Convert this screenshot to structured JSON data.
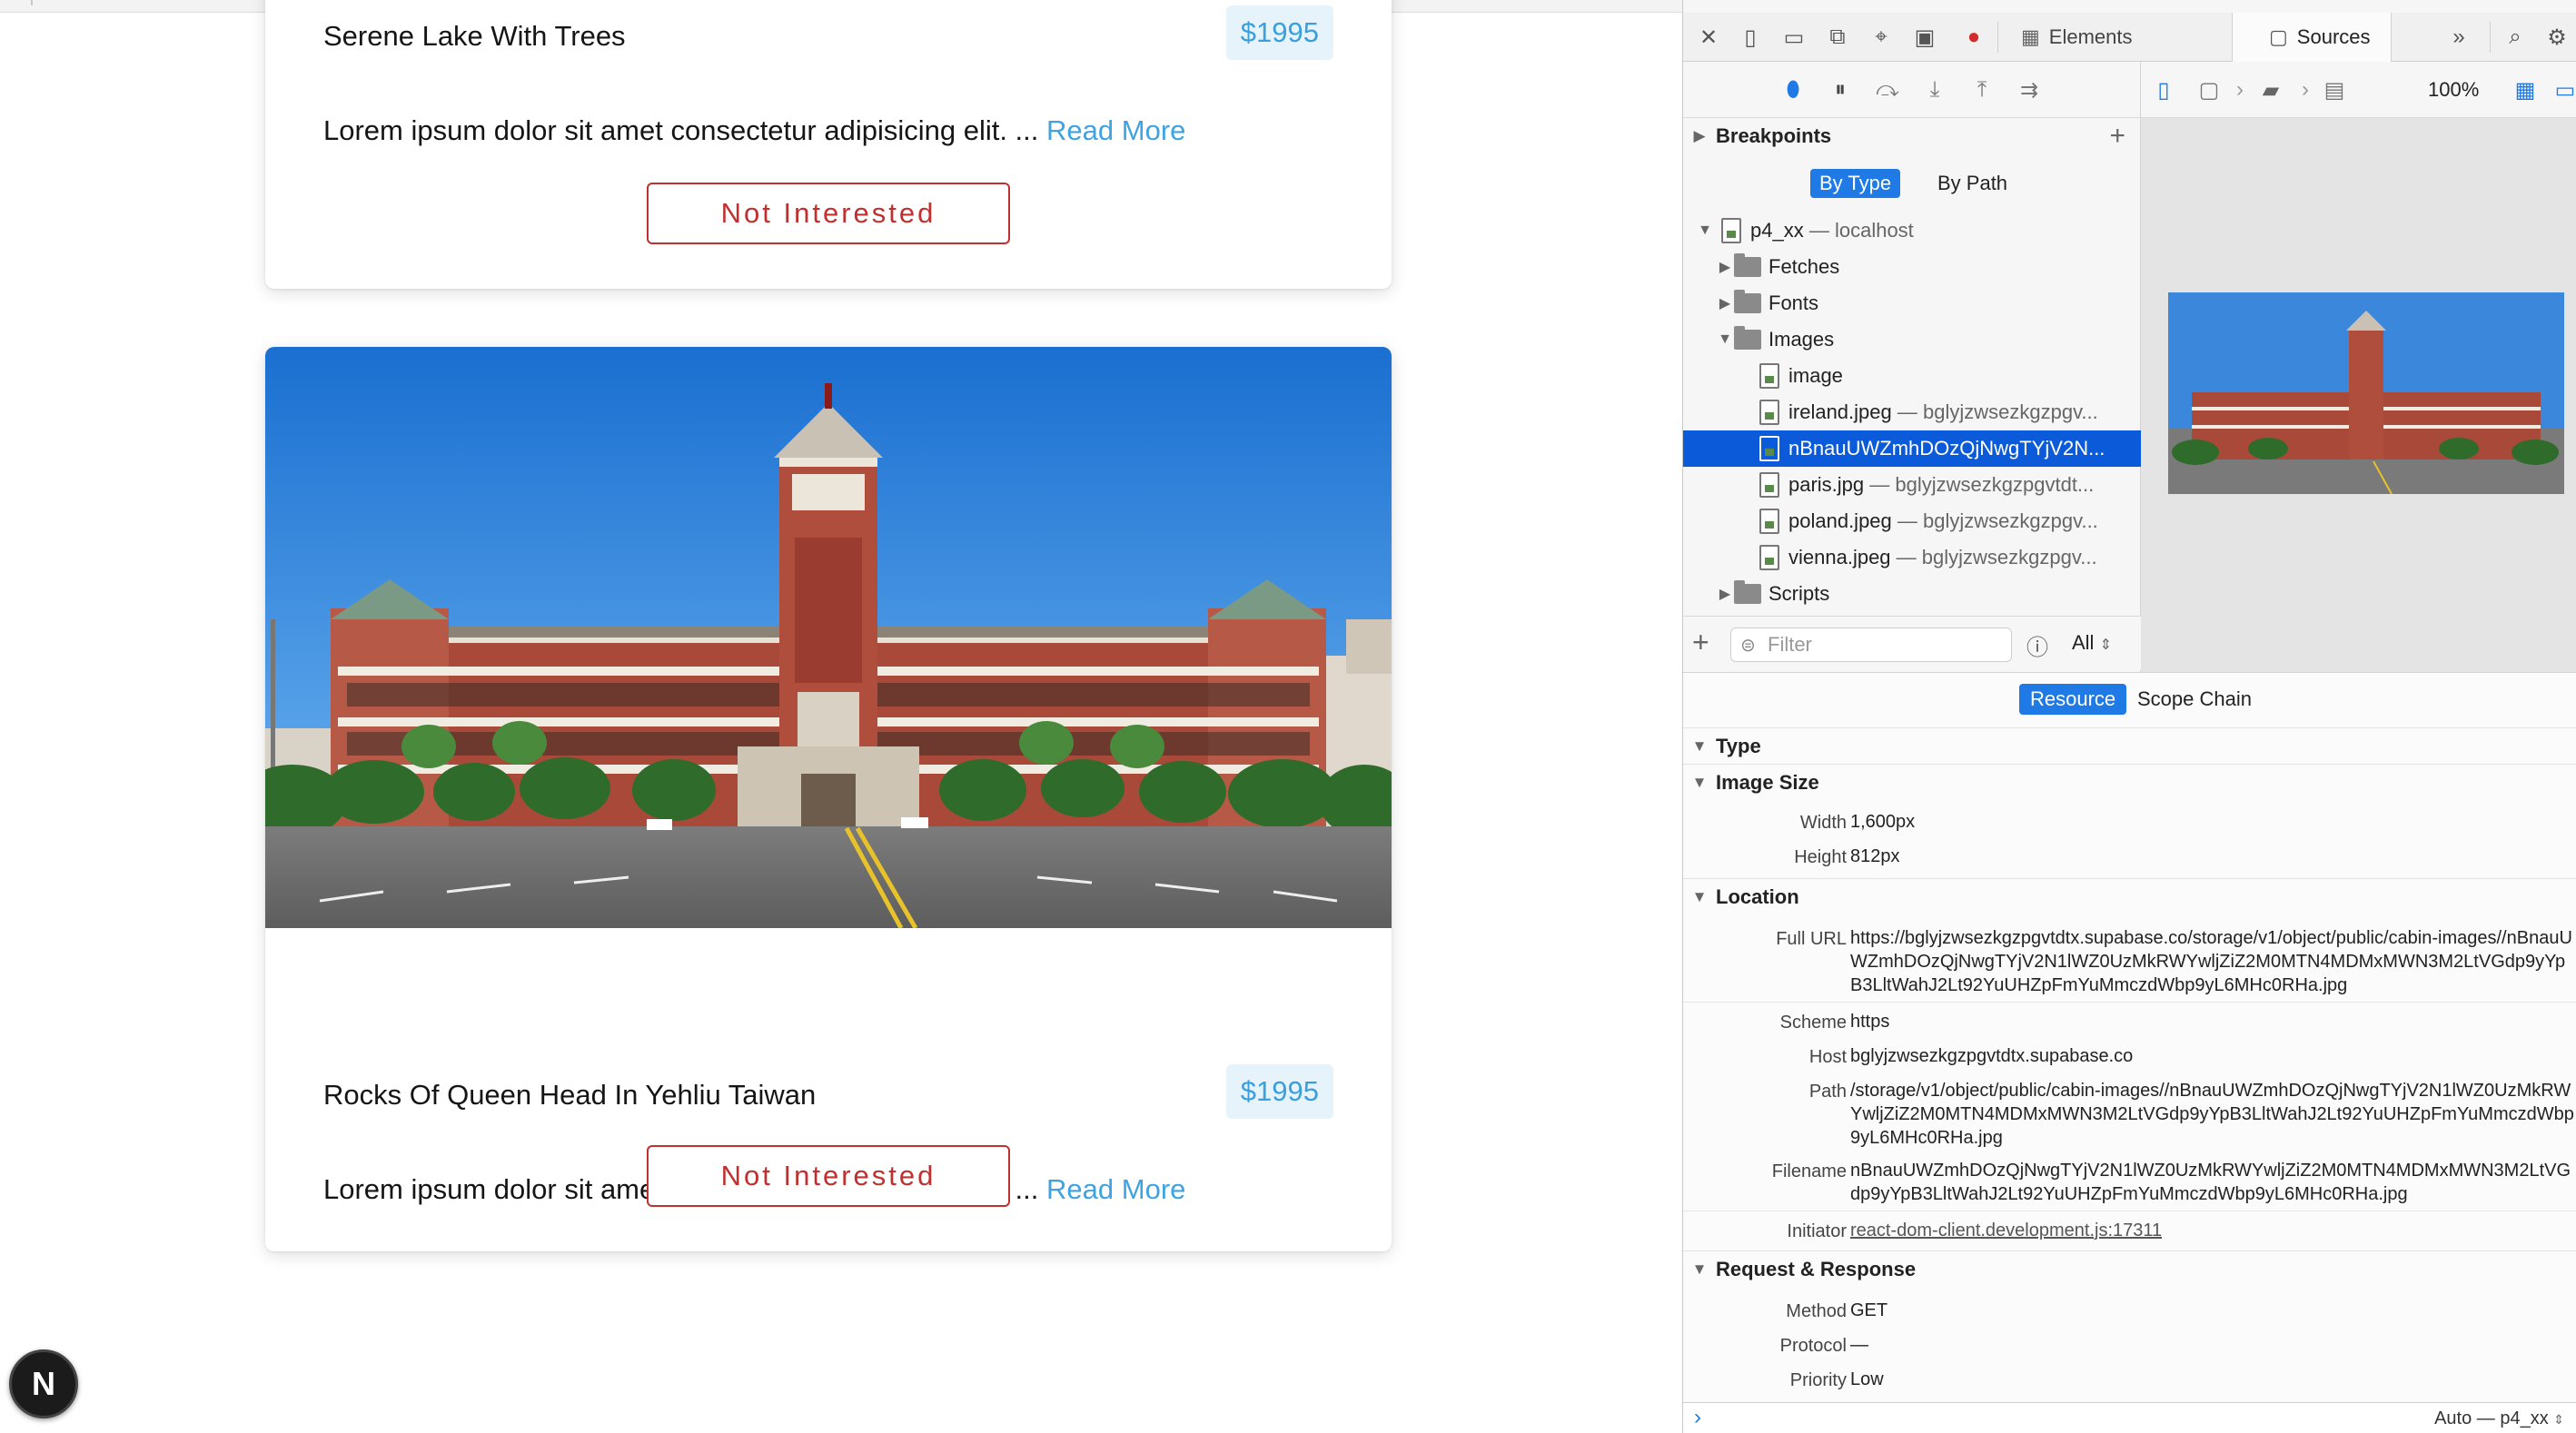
{
  "cards": [
    {
      "title": "Serene Lake With Trees",
      "price": "$1995",
      "description": "Lorem ipsum dolor sit amet consectetur adipisicing elit. ...",
      "read_more": "Read More",
      "button": "Not Interested"
    },
    {
      "title": "Rocks Of Queen Head In Yehliu Taiwan",
      "price": "$1995",
      "description": "Lorem ipsum dolor sit amet consectetur adipisicing elit. ...",
      "read_more": "Read More",
      "button": "Not Interested"
    }
  ],
  "next_badge": "N",
  "devtools": {
    "tabs": {
      "elements": "Elements",
      "sources": "Sources"
    },
    "breakpoints": {
      "title": "Breakpoints",
      "by_type": "By Type",
      "by_path": "By Path"
    },
    "tree": {
      "root_name": "p4_xx",
      "root_host": "— localhost",
      "fetches": "Fetches",
      "fonts": "Fonts",
      "images": "Images",
      "files": [
        {
          "name": "image",
          "origin": ""
        },
        {
          "name": "ireland.jpeg",
          "origin": "— bglyjzwsezkgzpgv..."
        },
        {
          "name": "nBnauUWZmhDOzQjNwgTYjV2N...",
          "origin": ""
        },
        {
          "name": "paris.jpg",
          "origin": "— bglyjzwsezkgzpgvtdt..."
        },
        {
          "name": "poland.jpeg",
          "origin": "— bglyjzwsezkgzpgv..."
        },
        {
          "name": "vienna.jpeg",
          "origin": "— bglyjzwsezkgzpgv..."
        }
      ],
      "scripts": "Scripts"
    },
    "filter": {
      "placeholder": "Filter",
      "scope": "All"
    },
    "zoom": "100%",
    "details": {
      "resource_tab": "Resource",
      "scope_tab": "Scope Chain",
      "type_title": "Type",
      "image_size_title": "Image Size",
      "width_label": "Width",
      "width_value": "1,600px",
      "height_label": "Height",
      "height_value": "812px",
      "location_title": "Location",
      "full_url_label": "Full URL",
      "full_url_value": "https://bglyjzwsezkgzpgvtdtx.supabase.co/storage/v1/object/public/cabin-images//nBnauUWZmhDOzQjNwgTYjV2N1lWZ0UzMkRWYwljZiZ2M0MTN4MDMxMWN3M2LtVGdp9yYpB3LltWahJ2Lt92YuUHZpFmYuMmczdWbp9yL6MHc0RHa.jpg",
      "scheme_label": "Scheme",
      "scheme_value": "https",
      "host_label": "Host",
      "host_value": "bglyjzwsezkgzpgvtdtx.supabase.co",
      "path_label": "Path",
      "path_value": "/storage/v1/object/public/cabin-images//nBnauUWZmhDOzQjNwgTYjV2N1lWZ0UzMkRWYwljZiZ2M0MTN4MDMxMWN3M2LtVGdp9yYpB3LltWahJ2Lt92YuUHZpFmYuMmczdWbp9yL6MHc0RHa.jpg",
      "filename_label": "Filename",
      "filename_value": "nBnauUWZmhDOzQjNwgTYjV2N1lWZ0UzMkRWYwljZiZ2M0MTN4MDMxMWN3M2LtVGdp9yYpB3LltWahJ2Lt92YuUHZpFmYuMmczdWbp9yL6MHc0RHa.jpg",
      "initiator_label": "Initiator",
      "initiator_value": "react-dom-client.development.js:17311",
      "reqres_title": "Request & Response",
      "method_label": "Method",
      "method_value": "GET",
      "protocol_label": "Protocol",
      "protocol_value": "—",
      "priority_label": "Priority",
      "priority_value": "Low"
    },
    "console_context": "Auto — p4_xx"
  }
}
